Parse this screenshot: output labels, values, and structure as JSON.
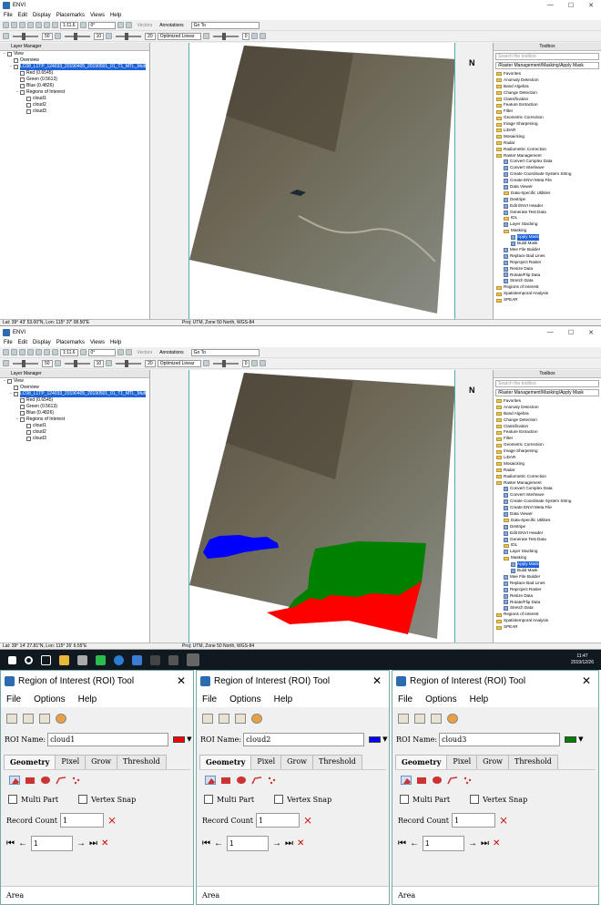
{
  "app": {
    "title": "ENVI",
    "menu": [
      "File",
      "Edit",
      "Display",
      "Placemarks",
      "Views",
      "Help"
    ],
    "toolbar": {
      "zoom": "1:11.6",
      "rotate": "0°",
      "vectors": "Vectors",
      "annotations": "Annotations",
      "goto": "Go To",
      "stretch": "Optimized Linear",
      "brightness": "50",
      "contrast": "10",
      "sharpen": "20",
      "transparency": "0"
    }
  },
  "layer_manager": {
    "title": "Layer Manager",
    "items": [
      {
        "label": "View",
        "indent": 0,
        "expand": "-"
      },
      {
        "label": "Overview",
        "indent": 1,
        "expand": ""
      },
      {
        "label": "LC08_L1TP_124033_20190405_20190501_01_T1_MTL_Mult",
        "indent": 1,
        "expand": "-",
        "highlight": true
      },
      {
        "label": "Red (0.6545)",
        "indent": 2,
        "expand": ""
      },
      {
        "label": "Green (0.5613)",
        "indent": 2,
        "expand": ""
      },
      {
        "label": "Blue (0.4826)",
        "indent": 2,
        "expand": ""
      },
      {
        "label": "Regions of Interest",
        "indent": 2,
        "expand": "-"
      },
      {
        "label": "cloud1",
        "indent": 3,
        "expand": ""
      },
      {
        "label": "cloud2",
        "indent": 3,
        "expand": ""
      },
      {
        "label": "cloud3",
        "indent": 3,
        "expand": ""
      }
    ]
  },
  "toolbox": {
    "title": "Toolbox",
    "search_placeholder": "Search the toolbox",
    "path": "/Raster Management/Masking/Apply Mask",
    "items": [
      {
        "label": "Favorites",
        "level": 0,
        "kind": "folder"
      },
      {
        "label": "Anomaly Detection",
        "level": 0,
        "kind": "folder"
      },
      {
        "label": "Band Algebra",
        "level": 0,
        "kind": "folder"
      },
      {
        "label": "Change Detection",
        "level": 0,
        "kind": "folder"
      },
      {
        "label": "Classification",
        "level": 0,
        "kind": "folder"
      },
      {
        "label": "Feature Extraction",
        "level": 0,
        "kind": "folder"
      },
      {
        "label": "Filter",
        "level": 0,
        "kind": "folder"
      },
      {
        "label": "Geometric Correction",
        "level": 0,
        "kind": "folder"
      },
      {
        "label": "Image Sharpening",
        "level": 0,
        "kind": "folder"
      },
      {
        "label": "LiDAR",
        "level": 0,
        "kind": "folder"
      },
      {
        "label": "Mosaicking",
        "level": 0,
        "kind": "folder"
      },
      {
        "label": "Radar",
        "level": 0,
        "kind": "folder"
      },
      {
        "label": "Radiometric Correction",
        "level": 0,
        "kind": "folder"
      },
      {
        "label": "Raster Management",
        "level": 0,
        "kind": "folder"
      },
      {
        "label": "Convert Complex Data",
        "level": 1,
        "kind": "tool"
      },
      {
        "label": "Convert Interleave",
        "level": 1,
        "kind": "tool"
      },
      {
        "label": "Create Coordinate System String",
        "level": 1,
        "kind": "tool"
      },
      {
        "label": "Create ENVI Meta File",
        "level": 1,
        "kind": "tool"
      },
      {
        "label": "Data Viewer",
        "level": 1,
        "kind": "tool"
      },
      {
        "label": "Data-Specific Utilities",
        "level": 1,
        "kind": "folder"
      },
      {
        "label": "Destripe",
        "level": 1,
        "kind": "tool"
      },
      {
        "label": "Edit ENVI Header",
        "level": 1,
        "kind": "tool"
      },
      {
        "label": "Generate Test Data",
        "level": 1,
        "kind": "tool"
      },
      {
        "label": "IDL",
        "level": 1,
        "kind": "folder"
      },
      {
        "label": "Layer Stacking",
        "level": 1,
        "kind": "tool"
      },
      {
        "label": "Masking",
        "level": 1,
        "kind": "folder"
      },
      {
        "label": "Apply Mask",
        "level": 2,
        "kind": "tool",
        "highlight": true
      },
      {
        "label": "Build Mask",
        "level": 2,
        "kind": "tool"
      },
      {
        "label": "Mee File Builder",
        "level": 1,
        "kind": "tool"
      },
      {
        "label": "Replace Bad Lines",
        "level": 1,
        "kind": "tool"
      },
      {
        "label": "Reproject Raster",
        "level": 1,
        "kind": "tool"
      },
      {
        "label": "Resize Data",
        "level": 1,
        "kind": "tool"
      },
      {
        "label": "Rotate/Flip Data",
        "level": 1,
        "kind": "tool"
      },
      {
        "label": "Stretch Data",
        "level": 1,
        "kind": "tool"
      },
      {
        "label": "Regions of Interest",
        "level": 0,
        "kind": "folder"
      },
      {
        "label": "Spatiotemporal Analysis",
        "level": 0,
        "kind": "folder"
      },
      {
        "label": "SPEAR",
        "level": 0,
        "kind": "folder"
      }
    ]
  },
  "status_top": {
    "latlon": "Lat: 39° 43' 53.00\"N, Lon: 115° 37' 08.50\"E",
    "proj": "Proj: UTM, Zone 50 North, WGS-84"
  },
  "status_mid": {
    "latlon": "Lat: 39° 14' 27.81\"N, Lon: 115° 26' 6.55\"E",
    "proj": "Proj: UTM, Zone 50 North, WGS-84"
  },
  "north": "N",
  "taskbar": {
    "time": "11:47",
    "date": "2019/12/26"
  },
  "roi_panels": [
    {
      "title": "Region of Interest (ROI) Tool",
      "name": "cloud1",
      "color": "#ff0000",
      "record_count": "1",
      "record_index": "1"
    },
    {
      "title": "Region of Interest (ROI) Tool",
      "name": "cloud2",
      "color": "#0000ff",
      "record_count": "1",
      "record_index": "1"
    },
    {
      "title": "Region of Interest (ROI) Tool",
      "name": "cloud3",
      "color": "#008000",
      "record_count": "1",
      "record_index": "1"
    }
  ],
  "roi_labels": {
    "menu_file": "File",
    "menu_options": "Options",
    "menu_help": "Help",
    "roi_name": "ROI Name:",
    "tab_geometry": "Geometry",
    "tab_pixel": "Pixel",
    "tab_grow": "Grow",
    "tab_threshold": "Threshold",
    "multi_part": "Multi Part",
    "vertex_snap": "Vertex Snap",
    "record_count": "Record Count",
    "area": "Area"
  },
  "roi_shape_colors": {
    "cloud1": "#ff0000",
    "cloud2": "#0000ff",
    "cloud3": "#008000"
  }
}
